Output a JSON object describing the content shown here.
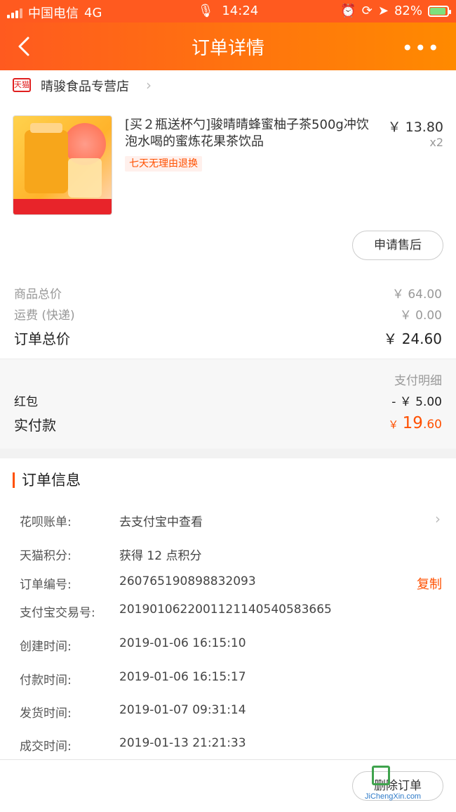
{
  "status_bar": {
    "carrier": "中国电信",
    "network": "4G",
    "time": "14:24",
    "battery": "82%"
  },
  "nav": {
    "title": "订单详情"
  },
  "shop": {
    "badge": "天猫",
    "name": "晴骏食品专营店"
  },
  "product": {
    "title": "[买２瓶送杯勺]骏晴晴蜂蜜柚子茶500g冲饮泡水喝的蜜炼花果茶饮品",
    "price": "￥ 13.80",
    "quantity": "x2",
    "tag": "七天无理由退换",
    "after_sale_button": "申请售后"
  },
  "totals": {
    "goods_label": "商品总价",
    "goods_value": "￥ 64.00",
    "shipping_label": "运费 (快递)",
    "shipping_value": "￥ 0.00",
    "order_total_label": "订单总价",
    "order_total_value": "￥ 24.60"
  },
  "payment": {
    "detail_link": "支付明细",
    "redpacket_label": "红包",
    "redpacket_value": "- ￥ 5.00",
    "paid_label": "实付款",
    "paid_currency": "￥",
    "paid_int": "19",
    "paid_dec": ".60"
  },
  "order_info": {
    "title": "订单信息",
    "rows": [
      {
        "key": "花呗账单:",
        "value": "去支付宝中查看"
      },
      {
        "key": "天猫积分:",
        "value": "获得 12 点积分"
      },
      {
        "key": "订单编号:",
        "value": "260765190898832093",
        "action": "复制"
      },
      {
        "key": "支付宝交易号:",
        "value": "2019010622001121140540583665"
      },
      {
        "key": "创建时间:",
        "value": "2019-01-06 16:15:10"
      },
      {
        "key": "付款时间:",
        "value": "2019-01-06 16:15:17"
      },
      {
        "key": "发货时间:",
        "value": "2019-01-07 09:31:14"
      },
      {
        "key": "成交时间:",
        "value": "2019-01-13 21:21:33"
      }
    ]
  },
  "bottom": {
    "delete_button": "删除订单",
    "watermark": "JiChengXin.com"
  },
  "colors": {
    "accent": "#ff5000",
    "nav_gradient_start": "#ff5a1f",
    "nav_gradient_end": "#ff8a00"
  }
}
